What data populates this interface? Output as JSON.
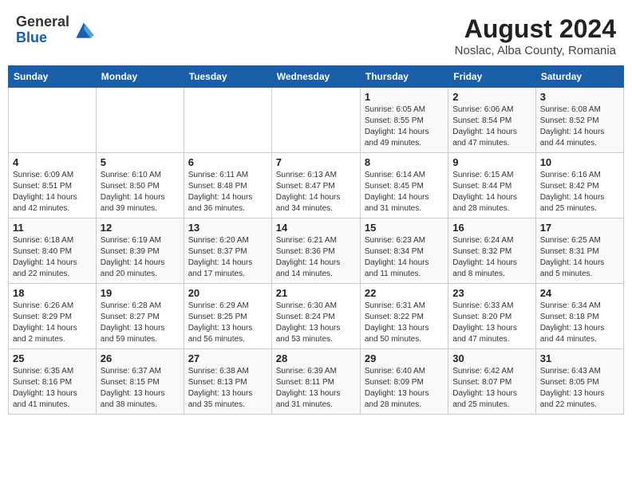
{
  "header": {
    "logo_line1": "General",
    "logo_line2": "Blue",
    "month_year": "August 2024",
    "location": "Noslac, Alba County, Romania"
  },
  "weekdays": [
    "Sunday",
    "Monday",
    "Tuesday",
    "Wednesday",
    "Thursday",
    "Friday",
    "Saturday"
  ],
  "weeks": [
    [
      {
        "day": "",
        "info": ""
      },
      {
        "day": "",
        "info": ""
      },
      {
        "day": "",
        "info": ""
      },
      {
        "day": "",
        "info": ""
      },
      {
        "day": "1",
        "info": "Sunrise: 6:05 AM\nSunset: 8:55 PM\nDaylight: 14 hours\nand 49 minutes."
      },
      {
        "day": "2",
        "info": "Sunrise: 6:06 AM\nSunset: 8:54 PM\nDaylight: 14 hours\nand 47 minutes."
      },
      {
        "day": "3",
        "info": "Sunrise: 6:08 AM\nSunset: 8:52 PM\nDaylight: 14 hours\nand 44 minutes."
      }
    ],
    [
      {
        "day": "4",
        "info": "Sunrise: 6:09 AM\nSunset: 8:51 PM\nDaylight: 14 hours\nand 42 minutes."
      },
      {
        "day": "5",
        "info": "Sunrise: 6:10 AM\nSunset: 8:50 PM\nDaylight: 14 hours\nand 39 minutes."
      },
      {
        "day": "6",
        "info": "Sunrise: 6:11 AM\nSunset: 8:48 PM\nDaylight: 14 hours\nand 36 minutes."
      },
      {
        "day": "7",
        "info": "Sunrise: 6:13 AM\nSunset: 8:47 PM\nDaylight: 14 hours\nand 34 minutes."
      },
      {
        "day": "8",
        "info": "Sunrise: 6:14 AM\nSunset: 8:45 PM\nDaylight: 14 hours\nand 31 minutes."
      },
      {
        "day": "9",
        "info": "Sunrise: 6:15 AM\nSunset: 8:44 PM\nDaylight: 14 hours\nand 28 minutes."
      },
      {
        "day": "10",
        "info": "Sunrise: 6:16 AM\nSunset: 8:42 PM\nDaylight: 14 hours\nand 25 minutes."
      }
    ],
    [
      {
        "day": "11",
        "info": "Sunrise: 6:18 AM\nSunset: 8:40 PM\nDaylight: 14 hours\nand 22 minutes."
      },
      {
        "day": "12",
        "info": "Sunrise: 6:19 AM\nSunset: 8:39 PM\nDaylight: 14 hours\nand 20 minutes."
      },
      {
        "day": "13",
        "info": "Sunrise: 6:20 AM\nSunset: 8:37 PM\nDaylight: 14 hours\nand 17 minutes."
      },
      {
        "day": "14",
        "info": "Sunrise: 6:21 AM\nSunset: 8:36 PM\nDaylight: 14 hours\nand 14 minutes."
      },
      {
        "day": "15",
        "info": "Sunrise: 6:23 AM\nSunset: 8:34 PM\nDaylight: 14 hours\nand 11 minutes."
      },
      {
        "day": "16",
        "info": "Sunrise: 6:24 AM\nSunset: 8:32 PM\nDaylight: 14 hours\nand 8 minutes."
      },
      {
        "day": "17",
        "info": "Sunrise: 6:25 AM\nSunset: 8:31 PM\nDaylight: 14 hours\nand 5 minutes."
      }
    ],
    [
      {
        "day": "18",
        "info": "Sunrise: 6:26 AM\nSunset: 8:29 PM\nDaylight: 14 hours\nand 2 minutes."
      },
      {
        "day": "19",
        "info": "Sunrise: 6:28 AM\nSunset: 8:27 PM\nDaylight: 13 hours\nand 59 minutes."
      },
      {
        "day": "20",
        "info": "Sunrise: 6:29 AM\nSunset: 8:25 PM\nDaylight: 13 hours\nand 56 minutes."
      },
      {
        "day": "21",
        "info": "Sunrise: 6:30 AM\nSunset: 8:24 PM\nDaylight: 13 hours\nand 53 minutes."
      },
      {
        "day": "22",
        "info": "Sunrise: 6:31 AM\nSunset: 8:22 PM\nDaylight: 13 hours\nand 50 minutes."
      },
      {
        "day": "23",
        "info": "Sunrise: 6:33 AM\nSunset: 8:20 PM\nDaylight: 13 hours\nand 47 minutes."
      },
      {
        "day": "24",
        "info": "Sunrise: 6:34 AM\nSunset: 8:18 PM\nDaylight: 13 hours\nand 44 minutes."
      }
    ],
    [
      {
        "day": "25",
        "info": "Sunrise: 6:35 AM\nSunset: 8:16 PM\nDaylight: 13 hours\nand 41 minutes."
      },
      {
        "day": "26",
        "info": "Sunrise: 6:37 AM\nSunset: 8:15 PM\nDaylight: 13 hours\nand 38 minutes."
      },
      {
        "day": "27",
        "info": "Sunrise: 6:38 AM\nSunset: 8:13 PM\nDaylight: 13 hours\nand 35 minutes."
      },
      {
        "day": "28",
        "info": "Sunrise: 6:39 AM\nSunset: 8:11 PM\nDaylight: 13 hours\nand 31 minutes."
      },
      {
        "day": "29",
        "info": "Sunrise: 6:40 AM\nSunset: 8:09 PM\nDaylight: 13 hours\nand 28 minutes."
      },
      {
        "day": "30",
        "info": "Sunrise: 6:42 AM\nSunset: 8:07 PM\nDaylight: 13 hours\nand 25 minutes."
      },
      {
        "day": "31",
        "info": "Sunrise: 6:43 AM\nSunset: 8:05 PM\nDaylight: 13 hours\nand 22 minutes."
      }
    ]
  ]
}
